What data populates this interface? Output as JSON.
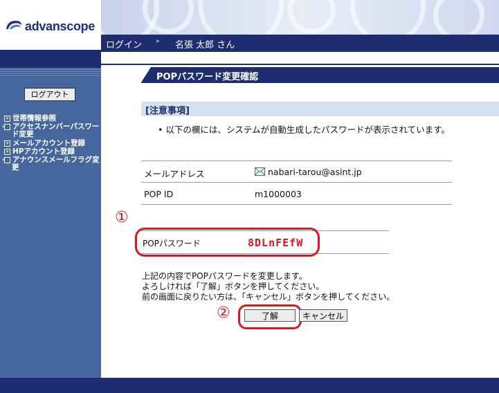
{
  "brand": {
    "logo_text": "advanscope"
  },
  "nav": {
    "login_label": "ログイン",
    "separator": "▸",
    "user_label": "名張 太郎 さん"
  },
  "sidebar": {
    "logout_label": "ログアウト",
    "items": [
      {
        "label": "世帯情報参照"
      },
      {
        "label": "アクセスナンバーパスワード変更"
      },
      {
        "label": "メールアカウント登録"
      },
      {
        "label": "HPアカウント登録"
      },
      {
        "label": "アナウンスメールフラグ変更"
      }
    ]
  },
  "page": {
    "title": "POPパスワード変更確認",
    "notice_title": "[注意事項]",
    "notice_text": "• 以下の欄には、システムが自動生成したパスワードが表示されています。"
  },
  "table": {
    "mail_label": "メールアドレス",
    "mail_value": "nabari-tarou@asint.jp",
    "popid_label": "POP ID",
    "popid_value": "m1000003",
    "pw_label": "POPパスワード",
    "pw_value": "8DLnFEfW"
  },
  "callouts": {
    "one": "①",
    "two": "②"
  },
  "message": {
    "line1": "上記の内容でPOPパスワードを変更します。",
    "line2": "よろしければ「了解」ボタンを押してください。",
    "line3": "前の画面に戻りたい方は、「キャンセル」ボタンを押してください。"
  },
  "buttons": {
    "ok_label": "了解",
    "cancel_label": "キャンセル"
  },
  "colors": {
    "nav_dark": "#1d2d70",
    "sidebar": "#45679e",
    "callout_red": "#e0141e",
    "password_red": "#e8101f"
  },
  "icons": {
    "mail": "mail-envelope-icon",
    "bullet": "square-plus-icon"
  }
}
